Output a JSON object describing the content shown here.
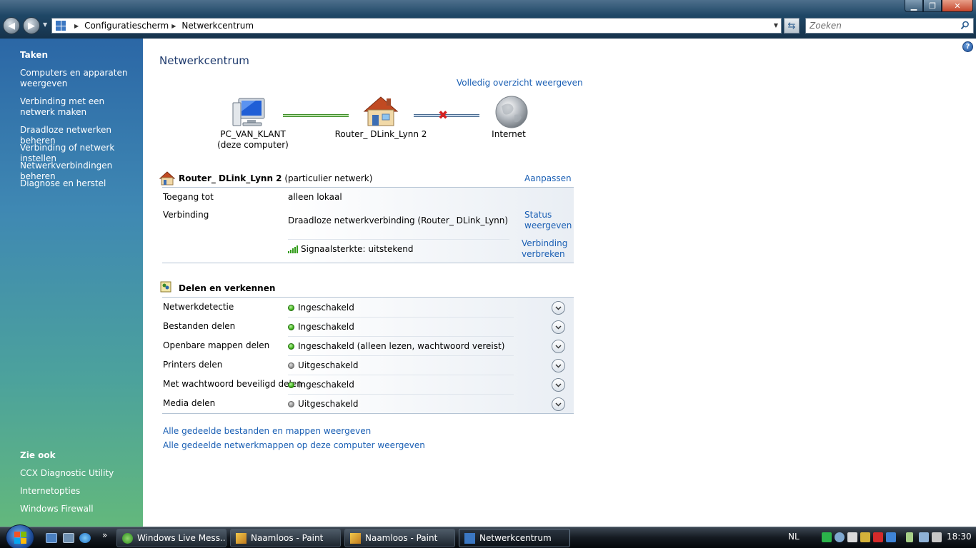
{
  "window": {
    "min_label": "▁",
    "max_label": "❐",
    "close_label": "✕"
  },
  "address": {
    "crumbs": [
      "Configuratiescherm",
      "Netwerkcentrum"
    ],
    "search_placeholder": "Zoeken"
  },
  "sidebar": {
    "tasks_title": "Taken",
    "tasks": [
      "Computers en apparaten weergeven",
      "Verbinding met een netwerk maken",
      "Draadloze netwerken beheren",
      "Verbinding of netwerk instellen",
      "Netwerkverbindingen beheren",
      "Diagnose en herstel"
    ],
    "seealso_title": "Zie ook",
    "seealso": [
      "CCX Diagnostic Utility",
      "Internetopties",
      "Windows Firewall"
    ]
  },
  "main": {
    "title": "Netwerkcentrum",
    "full_view_link": "Volledig overzicht weergeven",
    "map": {
      "computer": "PC_VAN_KLANT",
      "computer_sub": "(deze computer)",
      "router": "Router_ DLink_Lynn  2",
      "internet": "Internet"
    },
    "network": {
      "name": "Router_ DLink_Lynn  2",
      "type": "(particulier netwerk)",
      "customize_link": "Aanpassen",
      "access_label": "Toegang tot",
      "access_value": "alleen lokaal",
      "connection_label": "Verbinding",
      "connection_value": "Draadloze netwerkverbinding (Router_ DLink_Lynn)",
      "status_link": "Status weergeven",
      "signal_value": "Signaalsterkte: uitstekend",
      "disconnect_link": "Verbinding verbreken"
    },
    "sharing": {
      "title": "Delen en verkennen",
      "rows": [
        {
          "label": "Netwerkdetectie",
          "value": "Ingeschakeld",
          "state": "on"
        },
        {
          "label": "Bestanden delen",
          "value": "Ingeschakeld",
          "state": "on"
        },
        {
          "label": "Openbare mappen delen",
          "value": "Ingeschakeld (alleen lezen, wachtwoord vereist)",
          "state": "on"
        },
        {
          "label": "Printers delen",
          "value": "Uitgeschakeld",
          "state": "off"
        },
        {
          "label": "Met wachtwoord beveiligd delen",
          "value": "Ingeschakeld",
          "state": "on"
        },
        {
          "label": "Media delen",
          "value": "Uitgeschakeld",
          "state": "off"
        }
      ]
    },
    "bottom_links": [
      "Alle gedeelde bestanden en mappen weergeven",
      "Alle gedeelde netwerkmappen op deze computer weergeven"
    ]
  },
  "taskbar": {
    "tasks": [
      "Windows Live Mess...",
      "Naamloos - Paint",
      "Naamloos - Paint",
      "Netwerkcentrum"
    ],
    "language": "NL",
    "clock": "18:30"
  },
  "colors": {
    "link": "#1a5fb4",
    "title": "#1e3a6d",
    "enabled_dot": "#32a70d",
    "disabled_dot": "#888888"
  }
}
